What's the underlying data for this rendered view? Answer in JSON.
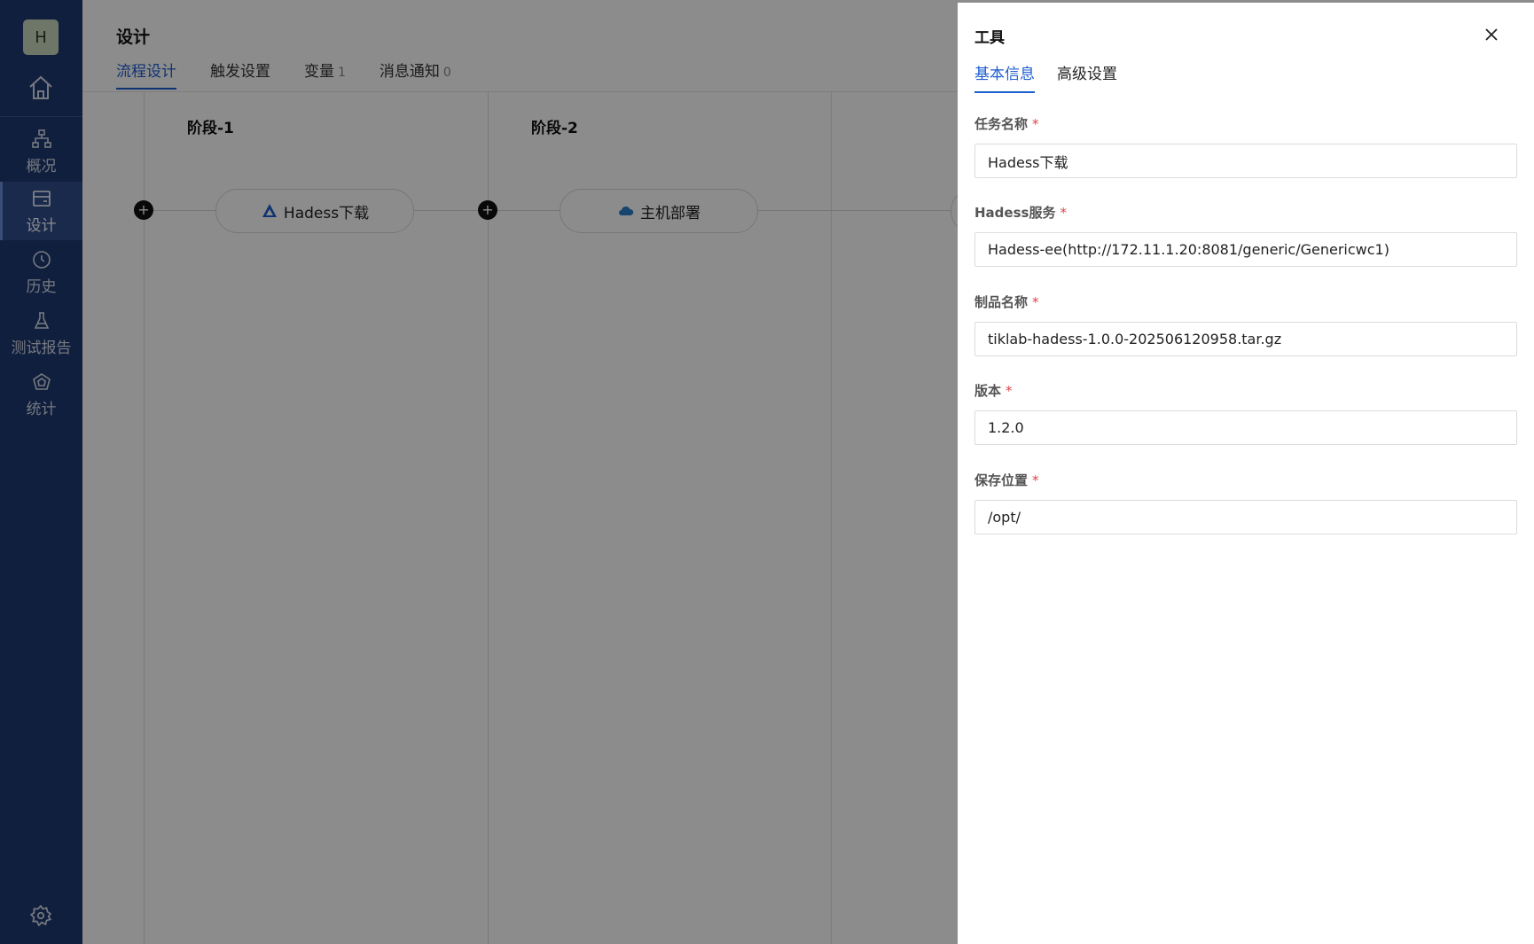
{
  "sidebar": {
    "avatar_letter": "H",
    "items": [
      {
        "label": "概况",
        "icon": "overview-icon"
      },
      {
        "label": "设计",
        "icon": "design-icon",
        "active": true
      },
      {
        "label": "历史",
        "icon": "history-icon"
      },
      {
        "label": "测试报告",
        "icon": "flask-icon"
      },
      {
        "label": "统计",
        "icon": "statistics-icon"
      }
    ]
  },
  "main": {
    "title": "设计",
    "tabs": [
      {
        "label": "流程设计",
        "active": true
      },
      {
        "label": "触发设置"
      },
      {
        "label": "变量",
        "count": "1"
      },
      {
        "label": "消息通知",
        "count": "0"
      }
    ],
    "stages": [
      {
        "title": "阶段-1",
        "task": "Hadess下载"
      },
      {
        "title": "阶段-2",
        "task": "主机部署"
      }
    ],
    "add_stage_label": "+"
  },
  "drawer": {
    "title": "工具",
    "tabs": [
      {
        "label": "基本信息",
        "active": true
      },
      {
        "label": "高级设置"
      }
    ],
    "fields": [
      {
        "label": "任务名称",
        "value": "Hadess下载"
      },
      {
        "label": "Hadess服务",
        "value": "Hadess-ee(http://172.11.1.20:8081/generic/Genericwc1)"
      },
      {
        "label": "制品名称",
        "value": "tiklab-hadess-1.0.0-202506120958.tar.gz"
      },
      {
        "label": "版本",
        "value": "1.2.0"
      },
      {
        "label": "保存位置",
        "value": "/opt/"
      }
    ],
    "required_mark": "*"
  },
  "colors": {
    "sidebar": "#1f3a72",
    "accent": "#1d5ecf",
    "required": "#e0414a"
  }
}
